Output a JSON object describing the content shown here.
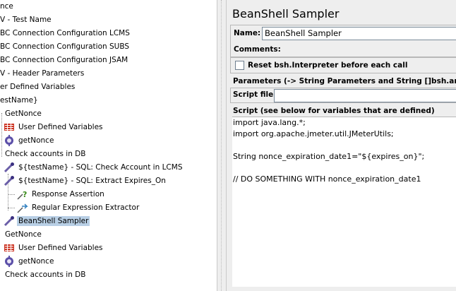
{
  "tree": {
    "items": [
      {
        "label": "nce",
        "icon": "none-icon"
      },
      {
        "label": "V - Test Name",
        "icon": "none-icon"
      },
      {
        "label": "BC Connection Configuration LCMS",
        "icon": "none-icon"
      },
      {
        "label": "BC Connection Configuration SUBS",
        "icon": "none-icon"
      },
      {
        "label": "BC Connection Configuration JSAM",
        "icon": "none-icon"
      },
      {
        "label": "V - Header Parameters",
        "icon": "none-icon"
      },
      {
        "label": "er Defined Variables",
        "icon": "none-icon"
      },
      {
        "label": "estName}",
        "icon": "none-icon"
      },
      {
        "label": "GetNonce",
        "icon": "none-icon"
      },
      {
        "label": "User Defined Variables",
        "icon": "udv-icon"
      },
      {
        "label": "getNonce",
        "icon": "gear-icon"
      },
      {
        "label": "Check accounts in DB",
        "icon": "none-icon"
      },
      {
        "label": "${testName} - SQL: Check Account in LCMS",
        "icon": "pipette-icon"
      },
      {
        "label": "${testName} - SQL: Extract Expires_On",
        "icon": "pipette-icon"
      },
      {
        "label": "Response Assertion",
        "icon": "assertion-icon"
      },
      {
        "label": "Regular Expression Extractor",
        "icon": "regex-icon"
      },
      {
        "label": "BeanShell Sampler",
        "icon": "pipette-icon",
        "selected": true
      },
      {
        "label": "GetNonce",
        "icon": "none-icon"
      },
      {
        "label": "User Defined Variables",
        "icon": "udv-icon"
      },
      {
        "label": "getNonce",
        "icon": "gear-icon"
      },
      {
        "label": "Check accounts in DB",
        "icon": "none-icon"
      }
    ]
  },
  "panel": {
    "title": "BeanShell Sampler",
    "name_label": "Name:",
    "name_value": "BeanShell Sampler",
    "comments_label": "Comments:",
    "reset_label": "Reset bsh.Interpreter before each call",
    "reset_checked": false,
    "parameters_label": "Parameters (-> String Parameters and String []bsh.args",
    "script_file_label": "Script file",
    "script_file_value": "",
    "script_label": "Script (see below for variables that are defined)",
    "script_lines": [
      "import java.lang.*;",
      "import org.apache.jmeter.util.JMeterUtils;",
      "",
      "String nonce_expiration_date1=\"${expires_on}\";",
      "",
      "// DO SOMETHING WITH nonce_expiration_date1"
    ]
  },
  "colors": {
    "selection": "#b8cfe5",
    "panel_bg": "#eeeeee"
  }
}
